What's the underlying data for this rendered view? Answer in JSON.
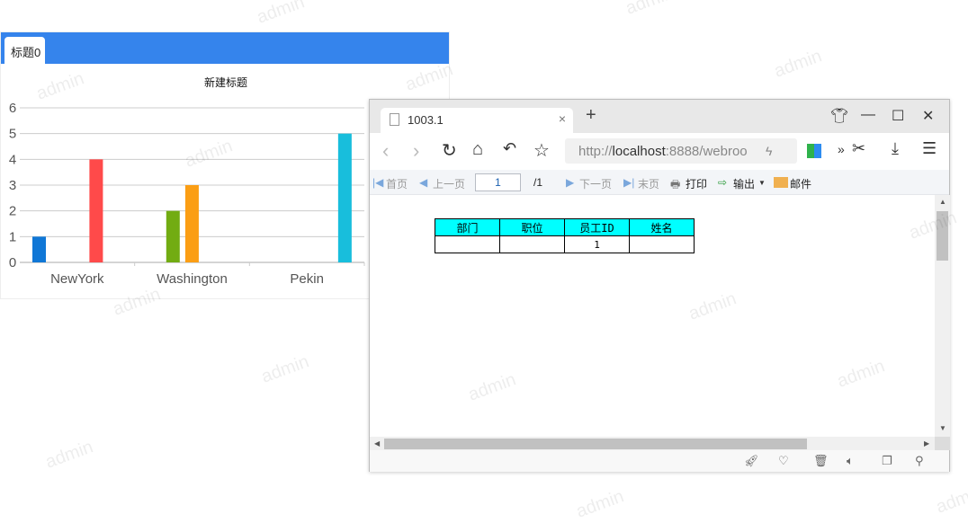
{
  "watermark": "admin",
  "panel": {
    "tab_label": "标题0"
  },
  "chart_data": {
    "type": "bar",
    "title": "新建标题",
    "categories": [
      "NewYork",
      "Washington",
      "Pekin"
    ],
    "series": [
      {
        "values": [
          1,
          0,
          0
        ],
        "color": "#1077d6"
      },
      {
        "values": [
          0,
          2,
          0
        ],
        "color": "#72ac12"
      },
      {
        "values": [
          0,
          3,
          0
        ],
        "color": "#fb9e14"
      },
      {
        "values": [
          4,
          0,
          0
        ],
        "color": "#ff4a4a"
      },
      {
        "values": [
          0,
          0,
          5
        ],
        "color": "#18bedc"
      }
    ],
    "ylim": [
      0,
      6
    ],
    "yticks": [
      "0",
      "1",
      "2",
      "3",
      "4",
      "5",
      "6"
    ],
    "grid": true,
    "xlabel": "",
    "ylabel": ""
  },
  "browser": {
    "tab_title": "1003.1",
    "url_prefix": "http://",
    "url_host": "localhost",
    "url_rest": ":8888/webroo",
    "toolbar": {
      "first": "首页",
      "prev": "上一页",
      "page": "1",
      "total": "/1",
      "next": "下一页",
      "last": "末页",
      "print": "打印",
      "export": "输出",
      "mail": "邮件"
    },
    "table": {
      "headers": [
        "部门",
        "职位",
        "员工ID",
        "姓名"
      ],
      "rows": [
        [
          "",
          "",
          "1",
          ""
        ]
      ]
    }
  }
}
